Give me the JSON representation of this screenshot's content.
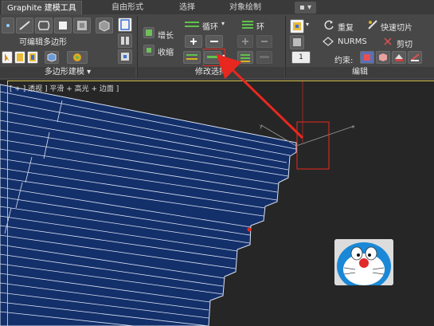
{
  "tabs": [
    {
      "label": "Graphite 建模工具",
      "active": true
    },
    {
      "label": "自由形式",
      "active": false
    },
    {
      "label": "选择",
      "active": false
    },
    {
      "label": "对象绘制",
      "active": false
    },
    {
      "label": "▪ ▾",
      "active": false
    }
  ],
  "poly_panel": {
    "title": "多边形建模 ▾",
    "editable_poly_label": "可编辑多边形"
  },
  "modify_panel": {
    "title": "修改选择",
    "grow_label": "增长",
    "shrink_label": "收缩",
    "loop_label": "循环",
    "ring_label": "环"
  },
  "edit_panel": {
    "title": "编辑",
    "repeat_label": "重复",
    "quickslice_label": "快速切片",
    "nurms_label": "NURMS",
    "cut_label": "剪切",
    "constraint_label": "约束:",
    "spinner_value": "1"
  },
  "viewport": {
    "label": "[ + ] 透视 ] 平滑 + 高光 + 边面 ]"
  },
  "colors": {
    "annotation_red": "#e8281f",
    "stair_blue": "#14306b",
    "edge_white": "#d9e2f2"
  },
  "icons": [
    "graphite-logo-icon",
    "doraemon-watermark-icon"
  ]
}
